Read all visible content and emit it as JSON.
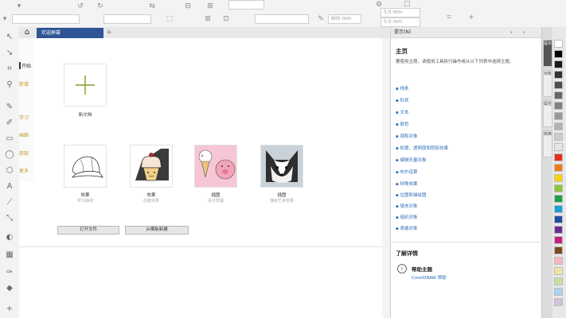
{
  "propbar": {
    "size_w": "5.0 mm",
    "size_h": "5.0 mm",
    "box1": "",
    "box2": "800 mm"
  },
  "tabs": {
    "welcome_label": "欢迎屏幕"
  },
  "leftnav": {
    "items": [
      "开始",
      "新增",
      "学习",
      "画廊",
      "获取",
      "更多"
    ]
  },
  "content": {
    "new_doc_label": "新文档",
    "templates": [
      {
        "label": "效果",
        "sub": "学习曲线",
        "icon": "cap-drawing-icon"
      },
      {
        "label": "效果",
        "sub": "创意效果",
        "icon": "cupcake-icon"
      },
      {
        "label": "插图",
        "sub": "设计草图",
        "icon": "icecream-pig-icon"
      },
      {
        "label": "插图",
        "sub": "描绘艺术效果",
        "icon": "husky-icon"
      }
    ],
    "open_file_button": "打开文件",
    "open_recent_button": "从模板新建"
  },
  "hints": {
    "panel_title": "提示(N)",
    "title": "主页",
    "description": "要使用主题，请使用工具执行操作或从以下列表中选择主题。",
    "links": [
      "线条",
      "形状",
      "文本",
      "颜色",
      "调和对象",
      "轮廓、透明度和阴影效果",
      "编辑矢量对象",
      "布尔运算",
      "特殊效果",
      "位图和描绘图",
      "填充对象",
      "组织对象",
      "表格对象"
    ],
    "more_title": "了解详情",
    "help_title": "帮助主题",
    "help_link": "CorelDRAW 帮助"
  },
  "docker_tabs": [
    "提示",
    "对象",
    "属性",
    "转换"
  ],
  "palette_colors": [
    "#ffffff",
    "#000000",
    "#1a1a1a",
    "#333333",
    "#4d4d4d",
    "#666666",
    "#808080",
    "#999999",
    "#b3b3b3",
    "#cccccc",
    "#e6e6e6",
    "#e0301e",
    "#f07a1a",
    "#f5d20f",
    "#8cc63e",
    "#1e9e48",
    "#1aa0d8",
    "#1f4fa3",
    "#6a2c91",
    "#c2227a",
    "#7a4a22",
    "#f4b6c2",
    "#f2e3a2",
    "#c8e0a2",
    "#a9d3f0",
    "#d6c0e0"
  ]
}
